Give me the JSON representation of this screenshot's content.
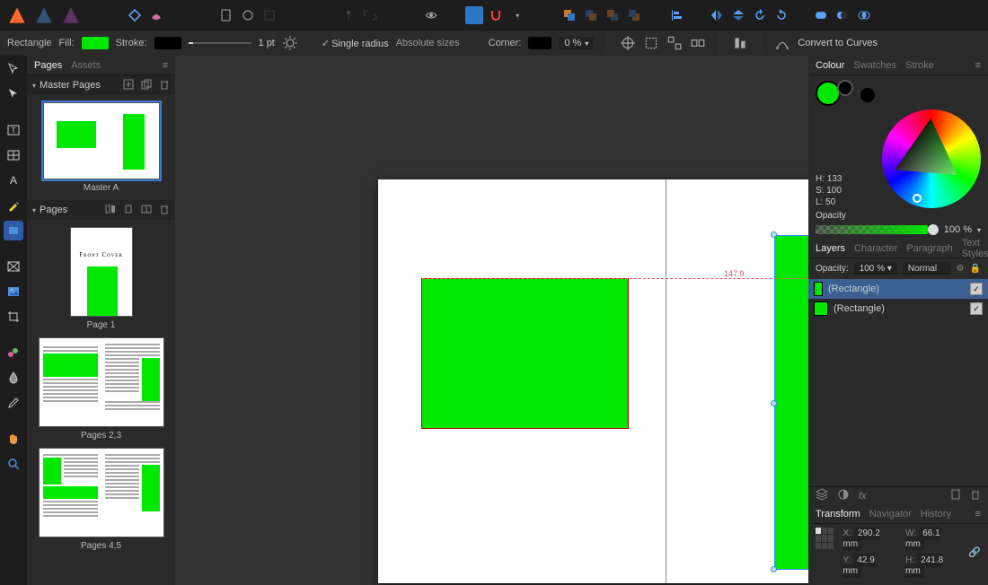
{
  "colors": {
    "accent_green": "#00e800",
    "selection_blue": "#2e8bff",
    "guide_red": "#e05c5c"
  },
  "context": {
    "tool_name": "Rectangle",
    "fill_label": "Fill:",
    "stroke_label": "Stroke:",
    "stroke_width": "1 pt",
    "single_radius": "Single radius",
    "absolute_sizes": "Absolute sizes",
    "corner_label": "Corner:",
    "corner_percent": "0 %",
    "convert_to_curves": "Convert to Curves"
  },
  "left": {
    "tabs": {
      "pages": "Pages",
      "assets": "Assets"
    },
    "master": {
      "header": "Master Pages",
      "items": [
        {
          "label": "Master A"
        }
      ]
    },
    "pages": {
      "header": "Pages",
      "items": [
        {
          "label": "Page 1",
          "cover_title": "Front Cover"
        },
        {
          "label": "Pages 2,3"
        },
        {
          "label": "Pages 4,5"
        }
      ]
    }
  },
  "canvas": {
    "guide_value": "147.9"
  },
  "right": {
    "colour": {
      "tabs": {
        "colour": "Colour",
        "swatches": "Swatches",
        "stroke": "Stroke"
      },
      "hsl": {
        "h": "H: 133",
        "s": "S: 100",
        "l": "L: 50"
      },
      "opacity_label": "Opacity",
      "opacity_value": "100 %"
    },
    "layers": {
      "tabs": {
        "layers": "Layers",
        "character": "Character",
        "paragraph": "Paragraph",
        "text_styles": "Text Styles"
      },
      "opacity_label": "Opacity:",
      "opacity_value": "100 %",
      "blend_mode": "Normal",
      "rows": [
        {
          "name": "(Rectangle)",
          "selected": true
        },
        {
          "name": "(Rectangle)",
          "selected": false
        }
      ]
    },
    "transform": {
      "tabs": {
        "transform": "Transform",
        "navigator": "Navigator",
        "history": "History"
      },
      "x": "290.2 mm",
      "y": "42.9 mm",
      "w": "66.1 mm",
      "h": "241.8 mm",
      "labels": {
        "x": "X:",
        "y": "Y:",
        "w": "W:",
        "h": "H:"
      }
    }
  }
}
